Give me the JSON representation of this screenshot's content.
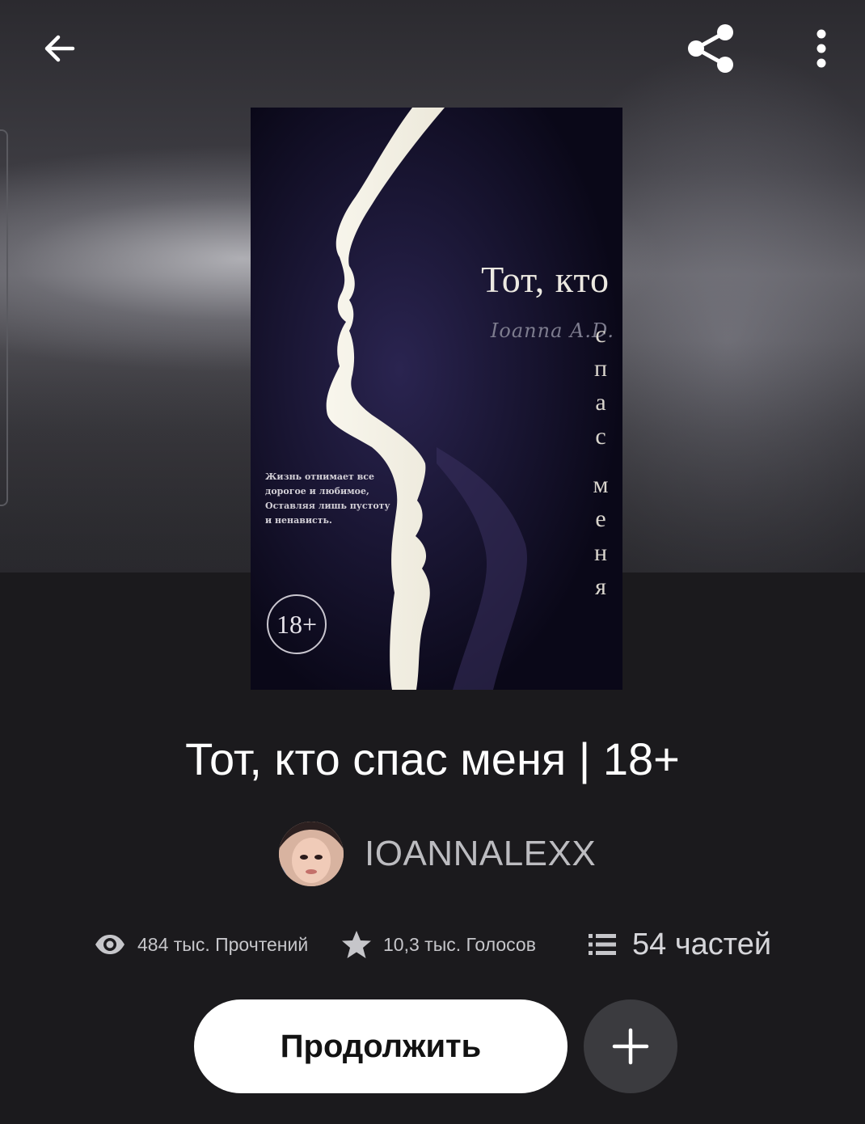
{
  "toolbar": {
    "back_icon": "arrow-left-icon",
    "share_icon": "share-icon",
    "more_icon": "more-vertical-icon"
  },
  "cover": {
    "author": "Ioanna A.D.",
    "title_line": "Тот, кто",
    "title_vertical": [
      "с",
      "п",
      "а",
      "с",
      "",
      "м",
      "е",
      "н",
      "я"
    ],
    "tagline": "Жизнь отнимает все дорогое и любимое, Оставляя лишь пустоту и ненависть.",
    "age_badge": "18+"
  },
  "book": {
    "title": "Тот, кто спас меня | 18+",
    "author": "IOANNALEXX"
  },
  "stats": {
    "reads": "484 тыс. Прочтений",
    "votes": "10,3 тыс. Голосов",
    "parts": "54 частей"
  },
  "actions": {
    "continue_label": "Продолжить",
    "add_icon": "plus-icon"
  },
  "colors": {
    "background": "#1b1a1d",
    "continue_bg": "#ffffff",
    "add_bg": "#3b3b3f"
  }
}
